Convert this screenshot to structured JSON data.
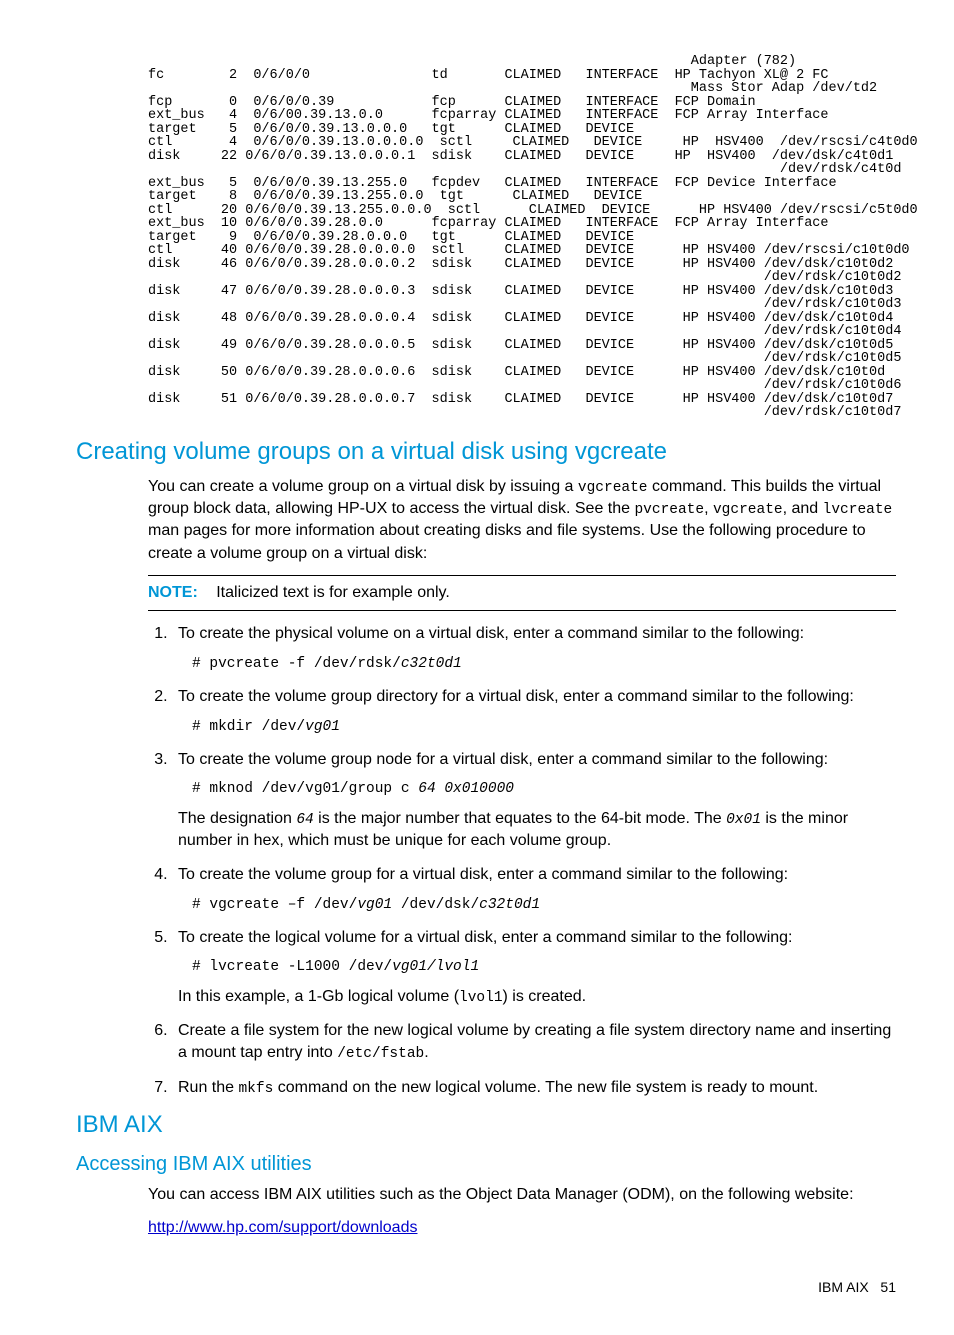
{
  "terminal": "                                                                   Adapter (782)\nfc        2  0/6/0/0               td       CLAIMED   INTERFACE  HP Tachyon XL@ 2 FC\n                                                                   Mass Stor Adap /dev/td2\nfcp       0  0/6/0/0.39            fcp      CLAIMED   INTERFACE  FCP Domain\next_bus   4  0/6/00.39.13.0.0      fcparray CLAIMED   INTERFACE  FCP Array Interface\ntarget    5  0/6/0/0.39.13.0.0.0   tgt      CLAIMED   DEVICE\nctl       4  0/6/0/0.39.13.0.0.0.0  sctl     CLAIMED   DEVICE     HP  HSV400  /dev/rscsi/c4t0d0\ndisk     22 0/6/0/0.39.13.0.0.0.1  sdisk    CLAIMED   DEVICE     HP  HSV400  /dev/dsk/c4t0d1\n                                                                              /dev/rdsk/c4t0d\next_bus   5  0/6/0/0.39.13.255.0   fcpdev   CLAIMED   INTERFACE  FCP Device Interface\ntarget    8  0/6/0/0.39.13.255.0.0  tgt      CLAIMED   DEVICE\nctl      20 0/6/0/0.39.13.255.0.0.0  sctl      CLAIMED  DEVICE      HP HSV400 /dev/rscsi/c5t0d0\next_bus  10 0/6/0/0.39.28.0.0      fcparray CLAIMED   INTERFACE  FCP Array Interface\ntarget    9  0/6/0/0.39.28.0.0.0   tgt      CLAIMED   DEVICE\nctl      40 0/6/0/0.39.28.0.0.0.0  sctl     CLAIMED   DEVICE      HP HSV400 /dev/rscsi/c10t0d0\ndisk     46 0/6/0/0.39.28.0.0.0.2  sdisk    CLAIMED   DEVICE      HP HSV400 /dev/dsk/c10t0d2\n                                                                            /dev/rdsk/c10t0d2\ndisk     47 0/6/0/0.39.28.0.0.0.3  sdisk    CLAIMED   DEVICE      HP HSV400 /dev/dsk/c10t0d3\n                                                                            /dev/rdsk/c10t0d3\ndisk     48 0/6/0/0.39.28.0.0.0.4  sdisk    CLAIMED   DEVICE      HP HSV400 /dev/dsk/c10t0d4\n                                                                            /dev/rdsk/c10t0d4\ndisk     49 0/6/0/0.39.28.0.0.0.5  sdisk    CLAIMED   DEVICE      HP HSV400 /dev/dsk/c10t0d5\n                                                                            /dev/rdsk/c10t0d5\ndisk     50 0/6/0/0.39.28.0.0.0.6  sdisk    CLAIMED   DEVICE      HP HSV400 /dev/dsk/c10t0d\n                                                                            /dev/rdsk/c10t0d6\ndisk     51 0/6/0/0.39.28.0.0.0.7  sdisk    CLAIMED   DEVICE      HP HSV400 /dev/dsk/c10t0d7\n                                                                            /dev/rdsk/c10t0d7",
  "headings": {
    "h2_vgcreate": "Creating volume groups on a virtual disk using vgcreate",
    "h2_ibmaix": "IBM AIX",
    "h3_access": "Accessing IBM AIX utilities"
  },
  "intro": {
    "pre1": "You can create a volume group on a virtual disk by issuing a ",
    "c1": "vgcreate",
    "post1": " command. This builds the virtual group block data, allowing HP-UX to access the virtual disk. See the ",
    "c2": "pvcreate",
    "c3": "vgcreate",
    "c4": "lvcreate",
    "post2": ", and ",
    "post3": " man pages for more information about creating disks and file systems. Use the following procedure to create a volume group on a virtual disk:"
  },
  "note": {
    "label": "NOTE:",
    "text": "Italicized text is for example only."
  },
  "steps": {
    "s1": {
      "text": "To create the physical volume on a virtual disk, enter a command similar to the following:",
      "cmd_pre": "# pvcreate -f /dev/rdsk/",
      "cmd_it": "c32t0d1"
    },
    "s2": {
      "text": "To create the volume group directory for a virtual disk, enter a command similar to the following:",
      "cmd_pre": "# mkdir /dev/",
      "cmd_it": "vg01"
    },
    "s3": {
      "text": "To create the volume group node for a virtual disk, enter a command similar to the following:",
      "cmd_pre": "# mknod /dev/vg01/group c ",
      "cmd_it": "64 0x010000",
      "extra_a": "The designation ",
      "extra_c1": "64",
      "extra_b": " is the major number that equates to the 64-bit mode. The ",
      "extra_c2": "0x01",
      "extra_c": " is the minor number in hex, which must be unique for each volume group."
    },
    "s4": {
      "text": "To create the volume group for a virtual disk, enter a command similar to the following:",
      "cmd_pre": "# vgcreate –f /dev/",
      "cmd_it1": "vg01",
      "cmd_mid": " /dev/dsk/",
      "cmd_it2": "c32t0d1"
    },
    "s5": {
      "text": "To create the logical volume for a virtual disk, enter a command similar to the following:",
      "cmd_pre": "# lvcreate -L1000 /dev/",
      "cmd_it": "vg01/lvol1",
      "extra_a": "In this example, a 1-Gb logical volume (",
      "extra_c": "lvol1",
      "extra_b": ") is created."
    },
    "s6": {
      "text_a": "Create a file system for the new logical volume by creating a file system directory name and inserting a mount tap entry into ",
      "code": "/etc/fstab",
      "text_b": "."
    },
    "s7": {
      "text_a": "Run the ",
      "code": " mkfs",
      "text_b": " command on the new logical volume. The new file system is ready to mount."
    }
  },
  "ibm": {
    "intro": "You can access IBM AIX utilities such as the Object Data Manager (ODM), on the following website:",
    "link": "http://www.hp.com/support/downloads"
  },
  "footer": {
    "label": "IBM AIX",
    "page": "51"
  }
}
